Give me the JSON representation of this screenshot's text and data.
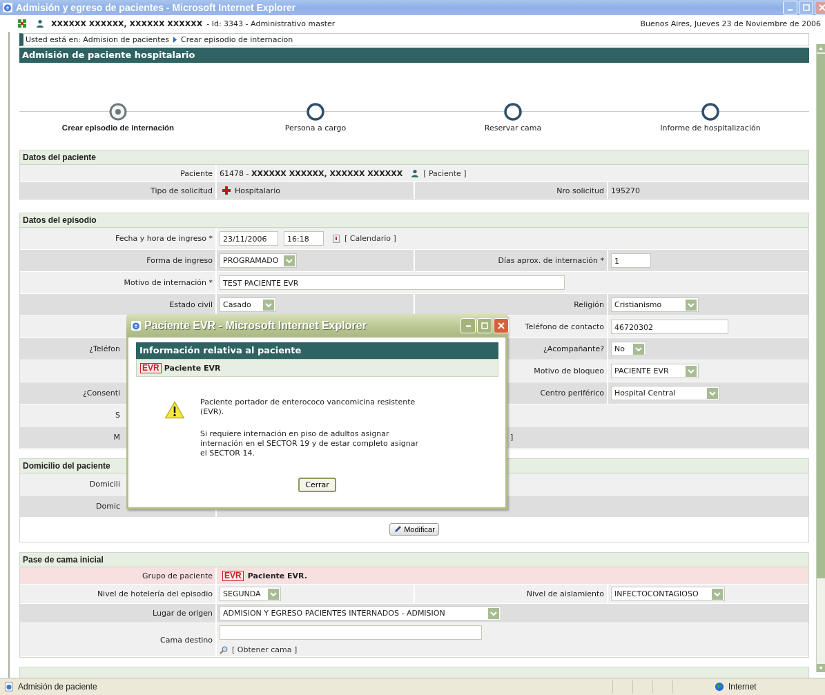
{
  "window": {
    "title": "Admisión y egreso de pacientes - Microsoft Internet Explorer"
  },
  "header": {
    "user": "XXXXXX XXXXXX, XXXXXX XXXXXX",
    "user_info": "- Id: 3343 - Administrativo master",
    "location_date": "Buenos Aires, Jueves 23 de Noviembre de 2006"
  },
  "breadcrumb": [
    "Usted está en: Admision de pacientes",
    "Crear episodio de internacion"
  ],
  "page_title": "Admisión de paciente hospitalario",
  "steps": [
    {
      "label": "Crear episodio de internación",
      "selected": true
    },
    {
      "label": "Persona a cargo",
      "selected": false
    },
    {
      "label": "Reservar cama",
      "selected": false
    },
    {
      "label": "Informe de hospitalización",
      "selected": false
    }
  ],
  "sections": [
    {
      "title": "Datos del paciente",
      "rows": [
        {
          "kind": "light",
          "cells": [
            {
              "label": "Paciente",
              "controls": [
                {
                  "kind": "rich_text",
                  "text": "61478 - **XXXXXX XXXXXX, XXXXXX XXXXXX**"
                },
                {
                  "kind": "person_link",
                  "text": "[ Paciente ]"
                }
              ]
            }
          ]
        },
        {
          "kind": "dark",
          "cells": [
            {
              "label": "Tipo de solicitud",
              "controls": [
                {
                  "kind": "cross_text",
                  "text": "Hospitalario"
                }
              ]
            },
            {
              "label": "Nro solicitud",
              "controls": [
                {
                  "kind": "text",
                  "text": "195270"
                }
              ]
            }
          ]
        }
      ]
    },
    {
      "title": "Datos del episodio",
      "rows": [
        {
          "kind": "light",
          "cells": [
            {
              "label": "Fecha y hora de ingreso *",
              "controls": [
                {
                  "kind": "input",
                  "value": "23/11/2006"
                },
                {
                  "kind": "input",
                  "value": "16:18"
                },
                {
                  "kind": "calendar_link",
                  "text": "[ Calendario ]"
                }
              ]
            }
          ]
        },
        {
          "kind": "dark",
          "cells": [
            {
              "label": "Forma de ingreso",
              "controls": [
                {
                  "kind": "select",
                  "value": "PROGRAMADO"
                }
              ]
            },
            {
              "label": "Días aprox. de internación *",
              "controls": [
                {
                  "kind": "input",
                  "value": "1"
                }
              ]
            }
          ]
        },
        {
          "kind": "light",
          "cells": [
            {
              "label": "Motivo de internación *",
              "controls": [
                {
                  "kind": "wide_input",
                  "value": "TEST PACIENTE EVR"
                }
              ]
            }
          ]
        },
        {
          "kind": "dark",
          "cells": [
            {
              "label": "Estado civil",
              "controls": [
                {
                  "kind": "select",
                  "value": "Casado"
                }
              ]
            },
            {
              "label": "Religión",
              "controls": [
                {
                  "kind": "select",
                  "value": "Cristianismo"
                }
              ]
            }
          ]
        },
        {
          "kind": "light",
          "cells": [
            {},
            {
              "label": "Teléfono de contacto",
              "controls": [
                {
                  "kind": "phone_input",
                  "value": "46720302"
                }
              ]
            }
          ]
        },
        {
          "kind": "dark",
          "cells": [
            {
              "label": "¿Teléfon",
              "covered": true
            },
            {
              "label": "¿Acompañante?",
              "controls": [
                {
                  "kind": "select",
                  "value": "No"
                }
              ]
            }
          ]
        },
        {
          "kind": "light",
          "cells": [
            {},
            {
              "label": "Motivo de bloqueo",
              "controls": [
                {
                  "kind": "select",
                  "value": "PACIENTE EVR"
                }
              ]
            }
          ]
        },
        {
          "kind": "dark",
          "cells": [
            {
              "label": "¿Consenti",
              "covered": true
            },
            {
              "label": "Centro periférico",
              "controls": [
                {
                  "kind": "select",
                  "value": "Hospital Central"
                }
              ]
            }
          ]
        },
        {
          "kind": "light",
          "cells": [
            {
              "label": "S",
              "covered": true
            }
          ]
        },
        {
          "kind": "dark",
          "cells": [
            {
              "label": "M",
              "covered": true,
              "controls": [
                {
                  "kind": "covered_text",
                  "text": "]"
                }
              ]
            }
          ]
        }
      ]
    },
    {
      "title": "Domicilio del paciente",
      "rows": [
        {
          "kind": "light",
          "cells": [
            {
              "label": "Domicili",
              "covered": true
            }
          ]
        },
        {
          "kind": "dark",
          "cells": [
            {
              "label": "Domic",
              "covered": true
            }
          ]
        },
        {
          "kind": "actions",
          "cells": [
            {
              "controls": [
                {
                  "kind": "button",
                  "text": "Modificar"
                }
              ]
            }
          ]
        }
      ]
    },
    {
      "title": "Pase de cama inicial",
      "rows": [
        {
          "kind": "alert",
          "cells": [
            {
              "label": "Grupo de paciente",
              "controls": [
                {
                  "kind": "evr_badge",
                  "badge": "EVR",
                  "text": "Paciente EVR."
                }
              ]
            }
          ]
        },
        {
          "kind": "light",
          "cells": [
            {
              "label": "Nivel de hotelería del episodio",
              "controls": [
                {
                  "kind": "select",
                  "value": "SEGUNDA"
                }
              ]
            },
            {
              "label": "Nivel de aislamiento",
              "controls": [
                {
                  "kind": "select",
                  "value": "INFECTOCONTAGIOSO"
                }
              ]
            }
          ]
        },
        {
          "kind": "dark",
          "cells": [
            {
              "label": "Lugar de origen",
              "controls": [
                {
                  "kind": "select",
                  "value": "ADMISION Y EGRESO PACIENTES INTERNADOS - ADMISION"
                }
              ]
            }
          ]
        },
        {
          "kind": "light",
          "cells": [
            {
              "label": "Cama destino",
              "controls": [
                {
                  "kind": "wide_input"
                },
                {
                  "kind": "search_link",
                  "text": "[ Obtener cama ]"
                }
              ]
            }
          ]
        }
      ]
    }
  ],
  "popup": {
    "title": "Paciente EVR - Microsoft Internet Explorer",
    "heading": "Información relativa al paciente",
    "badge": "EVR",
    "group": "Paciente EVR",
    "paragraphs": [
      "Paciente portador de enterococo vancomicina resistente (EVR).",
      "Si requiere internación en piso de adultos asignar internación en el SECTOR 19 y de estar completo asignar el SECTOR 14."
    ],
    "button": "Cerrar"
  },
  "status_bar": {
    "text": "Admisión de paciente",
    "zone": "Internet"
  }
}
